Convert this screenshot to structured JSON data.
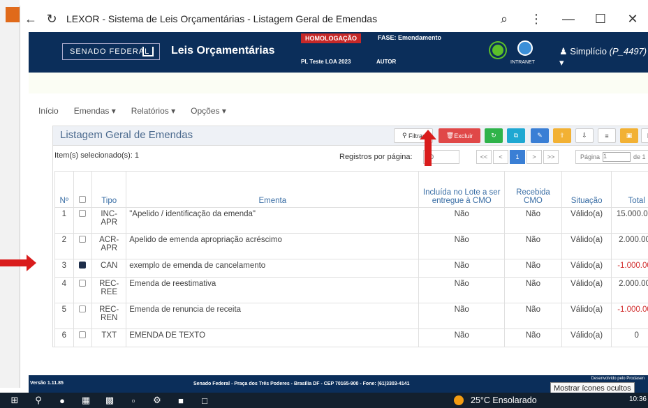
{
  "browser": {
    "title": "LEXOR - Sistema de Leis Orçamentárias - Listagem Geral de Emendas",
    "back_icon": "←",
    "reload_icon": "↻",
    "zoom_icon": "⌕",
    "menu_icon": "⋮",
    "min_icon": "—",
    "max_icon": "☐",
    "close_icon": "✕"
  },
  "header": {
    "org": "SENADO FEDERAL",
    "title": "Leis Orçamentárias",
    "env_badge": "HOMOLOGAÇÃO",
    "fase": "FASE: Emendamento",
    "pl": "PL Teste LOA 2023",
    "autor": "AUTOR",
    "intranet": "INTRANET",
    "user_name": "Simplício ",
    "user_id": "(P_4497)"
  },
  "nav": [
    "Início",
    "Emendas ▾",
    "Relatórios ▾",
    "Opções ▾"
  ],
  "panel": {
    "title": "Listagem Geral de Emendas",
    "filtrar": "Filtrar",
    "excluir": "Excluir",
    "selected": "Item(s) selecionado(s): 1",
    "registros_label": "Registros por página:",
    "registros_value": "50",
    "pager": [
      "<<",
      "<",
      "1",
      ">",
      ">>"
    ],
    "page_label": "Página",
    "page_value": "1",
    "page_of": "de 1"
  },
  "table": {
    "headers": [
      "Nº",
      "",
      "Tipo",
      "Ementa",
      "Incluída no Lote a ser entregue à CMO",
      "Recebida CMO",
      "Situação",
      "Total"
    ],
    "rows": [
      {
        "n": "1",
        "checked": false,
        "tipo": "INC-APR",
        "ementa": "\"Apelido / identificação da emenda\"",
        "lote": "Não",
        "recebida": "Não",
        "situacao": "Válido(a)",
        "total": "15.000.000",
        "neg": false
      },
      {
        "n": "2",
        "checked": false,
        "tipo": "ACR-APR",
        "ementa": "Apelido de emenda apropriação acréscimo",
        "lote": "Não",
        "recebida": "Não",
        "situacao": "Válido(a)",
        "total": "2.000.000",
        "neg": false
      },
      {
        "n": "3",
        "checked": true,
        "tipo": "CAN",
        "ementa": "exemplo de emenda de cancelamento",
        "lote": "Não",
        "recebida": "Não",
        "situacao": "Válido(a)",
        "total": "-1.000.000",
        "neg": true
      },
      {
        "n": "4",
        "checked": false,
        "tipo": "REC-REE",
        "ementa": "Emenda de reestimativa",
        "lote": "Não",
        "recebida": "Não",
        "situacao": "Válido(a)",
        "total": "2.000.000",
        "neg": false
      },
      {
        "n": "5",
        "checked": false,
        "tipo": "REC-REN",
        "ementa": "Emenda de renuncia de receita",
        "lote": "Não",
        "recebida": "Não",
        "situacao": "Válido(a)",
        "total": "-1.000.000",
        "neg": true
      },
      {
        "n": "6",
        "checked": false,
        "tipo": "TXT",
        "ementa": "EMENDA DE TEXTO",
        "lote": "Não",
        "recebida": "Não",
        "situacao": "Válido(a)",
        "total": "0",
        "neg": false
      }
    ]
  },
  "footer": {
    "version": "Versão 1.11.85",
    "address": "Senado Federal - Praça dos Três Poderes - Brasília DF - CEP 70165-900 - Fone: (61)3303-4141",
    "dev": "Desenvolvido pelo Prodasen"
  },
  "tooltip": "Mostrar ícones ocultos",
  "taskbar": {
    "weather": "25°C  Ensolarado",
    "time": "10:36"
  }
}
